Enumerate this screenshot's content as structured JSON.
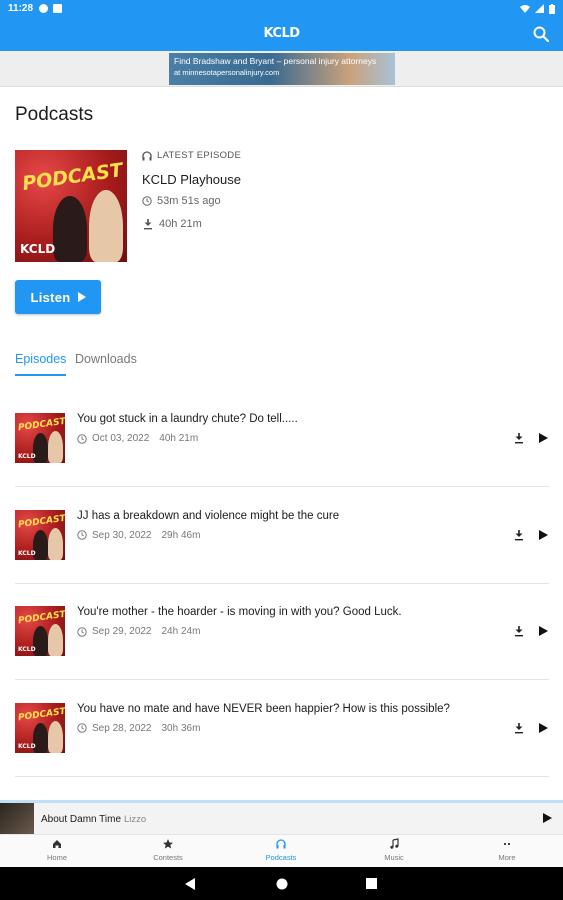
{
  "status_bar": {
    "time": "11:28"
  },
  "appbar": {
    "logo": "KCLD"
  },
  "ad": {
    "line1": "Find Bradshaw and Bryant – personal injury attorneys",
    "line2": "at minnesotapersonalinjury.com"
  },
  "page": {
    "title": "Podcasts"
  },
  "latest": {
    "label": "LATEST EPISODE",
    "name": "KCLD Playhouse",
    "ago": "53m 51s ago",
    "duration": "40h 21m"
  },
  "listen_button": {
    "label": "Listen"
  },
  "tabs": [
    {
      "label": "Episodes"
    },
    {
      "label": "Downloads"
    }
  ],
  "episodes": [
    {
      "title": "You got stuck in a laundry chute? Do tell.....",
      "date": "Oct 03, 2022",
      "duration": "40h 21m"
    },
    {
      "title": "JJ has a breakdown and violence might be the cure",
      "date": "Sep 30, 2022",
      "duration": "29h 46m"
    },
    {
      "title": "You're mother - the hoarder - is moving in with you? Good Luck.",
      "date": "Sep 29, 2022",
      "duration": "24h 24m"
    },
    {
      "title": "You have no mate and have NEVER been happier?  How is this possible?",
      "date": "Sep 28, 2022",
      "duration": "30h 36m"
    }
  ],
  "mini_player": {
    "title": "About Damn Time",
    "artist": "Lizzo"
  },
  "bottom_nav": [
    {
      "label": "Home",
      "icon": "home-icon"
    },
    {
      "label": "Contests",
      "icon": "star-icon"
    },
    {
      "label": "Podcasts",
      "icon": "headphones-icon"
    },
    {
      "label": "Music",
      "icon": "music-note-icon"
    },
    {
      "label": "More",
      "icon": "more-icon"
    }
  ],
  "colors": {
    "primary": "#2196f3",
    "accent_text": "#2196f3"
  }
}
